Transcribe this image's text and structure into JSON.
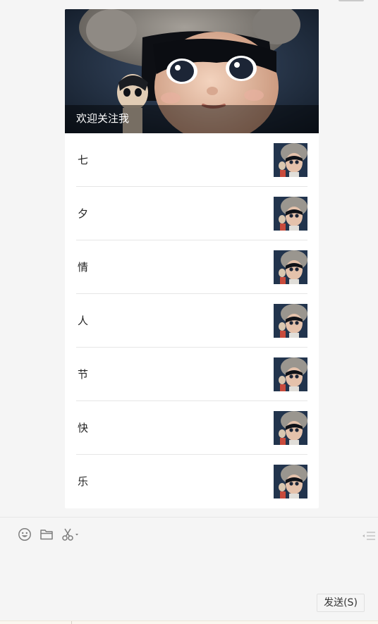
{
  "article": {
    "cover_title": "欢迎关注我",
    "items": [
      {
        "title": "七"
      },
      {
        "title": "夕"
      },
      {
        "title": "情"
      },
      {
        "title": "人"
      },
      {
        "title": "节"
      },
      {
        "title": "快"
      },
      {
        "title": "乐"
      }
    ]
  },
  "toolbar": {
    "icons": [
      "emoji-icon",
      "folder-icon",
      "scissors-icon"
    ]
  },
  "send_button": {
    "label": "发送(S)"
  },
  "colors": {
    "background": "#f5f5f5",
    "card": "#ffffff",
    "cover_overlay": "#000000",
    "divider": "#e6e6e6"
  }
}
